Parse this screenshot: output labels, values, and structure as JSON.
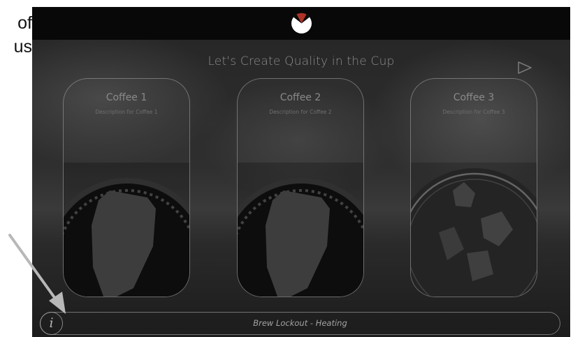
{
  "document_fragment": {
    "lines": [
      "of",
      "us"
    ]
  },
  "header": {
    "logo_icon": "coffee-cup-logo-icon"
  },
  "main": {
    "title": "Let's Create Quality in the Cup",
    "next_icon": "play-arrow-icon",
    "cards": [
      {
        "title": "Coffee 1",
        "description": "Description for Coffee 1",
        "image": "hot-coffee-cup-image"
      },
      {
        "title": "Coffee 2",
        "description": "Description for Coffee 2",
        "image": "hot-coffee-cup-image"
      },
      {
        "title": "Coffee 3",
        "description": "Description for Coffee 3",
        "image": "iced-coffee-glass-image"
      }
    ]
  },
  "footer": {
    "info_label": "i",
    "status": "Brew Lockout - Heating"
  },
  "colors": {
    "screen_background": "#2a2a2a",
    "header_background": "#080808",
    "text_muted": "#8d8d8d",
    "outline": "#a5a5a5"
  }
}
